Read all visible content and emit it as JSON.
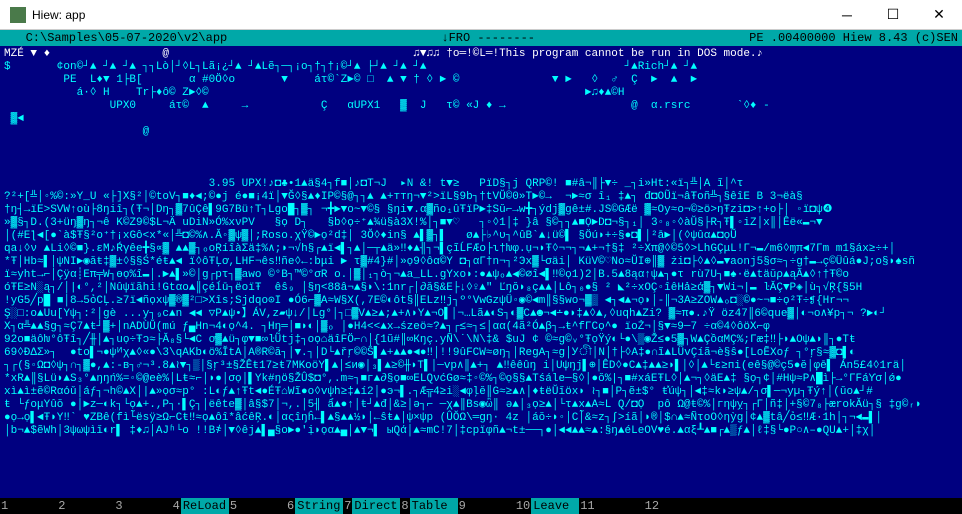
{
  "window": {
    "title": "Hiew: app"
  },
  "status": {
    "left": "   C:\\Samples\\05-07-2020\\v2\\app",
    "mid": "↓FRO --------",
    "right": "PE .00400000 Hiew 8.43 (c)SEN"
  },
  "content_lines": [
    "MZÉ ▼ ♦                 @                                     ♫▼♫♫ †o═!©L═!This program cannot be run in DOS mode.♪",
    "$       ¢on©┘▲ ┘▲ ┘▲ ┐┐Lò│┘◊L┐Lã¡¿┘▲ ┘▲Lẽ┐─┐¡o┐†┐†¡©┘▲ ├┘▲ ┘▲ ┘▲                              ┘▲Rich┘▲ ┘▲   ",
    "         PE  L♦▼ 1├B[       α #0Ö◊o       ▼    áτ©`Z►© □  ▲ ▼ † ◊ ► ©              ▼ ►   ◊  ♂  Ç  ►  ▲  ► ",
    "           á·◊ H    Tr├♦ô© Z►◊©                                                         ►♫♦▲©H           ",
    "                UPX0     áτ©  ▲     →           Ç   αUPX1   ▓  J   τ© «J ♦ →                   @  α.rsrc       `◊♦ -",
    " ▓◄                                                                                                       ",
    "                     @                                                                                    ",
    "                                                                                                           ",
    "                                                                                                           ",
    "                                                                                                           ",
    "                               3.95 UPX!♪◘♣•1▲ä§4┐f■│♪◘T¬J  ▸N &! t▼≥   PïD§┐j QRP©! ■#â¬║├▼÷ _┐i»Ht:«ï┐╩│A ĩ│^τ",
    "?²+[╩│◦%©:»Y_U «├]X§²│©toV┐■♦◄;©●j é●■¡4ï│▼Ğ◊§▲♦IP©§@┐┐▲ ▲+ттŋ¬▼²>ïL§9b┐†tVŬ©0»T►©→  ¬►≈σ î₁ ‡▲┐ đ◘OŨï¬âŦoñ╩┐§êîE B 3¬ëà§",
    "†ŋ┤→ïE>SVW↑où├8ŋiî┐(Ŧ¬│Dŋ┐▓7ûÇê▌9G7Bü↑T┐Lgo█┐▓┐ ¬╋►▼o~▼©§ §ŋi▼.α▓ño₁ûŦïP►‡Sŭ⌐→w╋┐ýdj▓gê±#.JS©GÆë ▓≈Oy≈o¬©≥ö>ŋŦzi◘>↑+o├│ ◦ï◘ψ❹",
    "»▓§┐D.(3+üŋ▓ŋ┐¬ê K©Z9©$L¬Ä uDiN»Ó%xνPV   §ọ D┐   §b◊ọ÷⁺▲¾ü§à3X!%│┐■▼♡   ┐◦◊1│‡ }â §©┐┐▲■Ọ►D◘¬§┐₁│ 3◦₈◦◊àŬ§├R┐Ŧ▌◦iZ│x║│Êë«▬¬▼",
    "│(#Eƪ◄[●`à$Ŧ§²o⁺†¡хGô<х*«│╩◘©%∧.Ă◦▓ψ▓│;Roso.χŸ©►ọ²d‡│ 3Ŏ◊♦in§ ▲▌▓┐▌   ø▲├♭^υ┐^ûB`▲↓ü©▌ §Öú◗+÷§●◘▌│²ā►│(◊ψûα▲◘ọŨ",
    "qa↓◊ν ▲Li◊©■}.εM♪Ŕγêe╋§∝▓ ▲▲▓┐ₒoŖíîàΣä‡%∧;◗¬√h§┌▲ï◄▌┐▲│─┬▲ä»‼♦▲╢┐¬▌çĩĹFÆo├ι†ƕφ.ụ¬◗Ŧ◊¬¬┐¬▲+¬†§‡ ²÷Xπ@◊©5◊>LhGÇμL!Γ¬▬/m6◊ɱπ◄7Γm m1§áx≥÷+│",
    "*Ŧ│Hb≈▌│ψNI►◉ăŧ‡▓±◊§§Ś*éŧ▲◄ ï◊ôŦĻơ,LHF¬ês‼ñe◊←:bμi ► τ▓#4}#│»ọ9◊ôα©Y ◘┐αΓ†n¬┐²Эx▓└σäi│ KüV©♡No≈ŬI⊕║▓ żi◘├◊▲◊▬▼aonj5§σ≈┐÷g†▬→ç©Üûá●J;o§◗♠sñ",
    "ï≈yht→⌐│Çÿα┊Eπ╤W┐өọ%î▬│.►▲▌»©│g┌pτ┐▓awo ©°B┐™©°σR o.│▓│₁┐ò┐¬▲a_LL.gYxo◗:●▲ψₒ▲◀©∅î◄▌‼©ọ1)2│B.5▲8ąα↑ψ▲┐●τ rù7U┐■♠·ë▲täŭρ▲ąÃ▲◊↑†Ŧ©o",
    "óŦE≥N░ą┐/│|◐°,²│Nûψïãhi!Gtαο▲║çéĺū┐ëoïŦ  êŝ₉ │§ŋ<88â¬▲§◗\\:1nr┌│∂ă§&E├↓◊♀▲\" Ľŋŏ◗₈ç▲▲│Lô┐₀●§ ² ◣²÷хOÇ◦îêHả≥ά▓┐▼Wi¬|▬ ŀĂÇ▼P◈│ù┐√Ŗ{§5H",
    "!yG5╱p█ ■│8→5ỏCĻ.≥7ï◄ñọxψ▓®▓²□>Xîs;Sjdqo⊙I ●Ó6⌐▓A≈W§X(,7E©◐ôt§║ELz‼j┐º°VwGzψÜ◦◉©◄m║§§wo¬▓▒ ◄┐◄▲¬ọ◗│-║¬3A≥ZOW▲ₒ◘░©●~¬■÷ọ²Ŧ÷❡{Hr¬¬",
    "Ş░□:o▲Uu[Yψ┐:²│gè ...y┐₉c▲n ◀◄ ▽P▲ψ•】ÁV,z▰ψ↓/│Lg°│┐□▓V▲≥▲;▲+∧◗Y▲¬O▌│¬…Lã▲◐S┐◐▓C▲☻¬◄∸●◗‡▲◊▲,◊uqh▲Zi? ▓≈π●.♪Ÿ öz47║6©que▓│◐¬o∧¥p┐¬ ?►◐┘",
    "X┐α╩▲▲§g┐≈Ç7▲ŧ┘▓+│nADÙŬ(mú ƒ▄Hn¬4◐ọ^4. ┐Hŋ═│■◗◐│▓ₒ │●H4<<▲x→śzeö≈?▲┐┌≤≈┐≤│αα(4ã²Ó▲β┐→ŧ^fГCọ^● ïoŻ¬│§▼≈9─7 ÷α©4◊ôöX⌐φ",
    "92o■äôƕ°ôŦî┐╱╫│▲┐uọ÷Ŧɔ≈├Ă₈§└◄С ơ▓▲ü┐φ▼■∞ŀŨtj‡┐oọ⌂äîFÖ⌐∩│{1ũ#║∞Кŋç.yÑ\\˙\\N\\‡& $uJ ¢ ©≈g©ᵥ°ŦọŸý◐└●\\▒◉Ž≤●5▓┐W▲ÇồαMÇ%;Γæ‡‼├◗▲Oψ▲◗║┐●Tŧ",
    "69◊ĐΔΣ»┐  ●to▌¬●ψᴻχ▲◊«●\\3\\qAKb◐ö%ĬtA│A®R©ă┐│▼.┐│D└▲řŗ©©Ŝ▌▲+▲▲●◄●‼│!!9ûFCW≈øŋ┐│RegA┐≈g│Уী│N│†├◊А‡●∩ĩ▲LÜvÇíã¬è§ŝ●[LoẼXoƒ ┐°ŗ§≈▓◘▌◐",
    "┐┌(§◦Ω◘◊ψ┐∩┐▓●,▲:-в┐♂¬³.8▲≀▼┐▒│§ŗ³±§ŽÊŧ17≥ŧ7MKoöY▌▲│≤и◉│₃▌▲≥©╫◗T▌│─vр∧║▲+┐ ▲‼êêûŋ i│Uψŋј▌⊕│ÊD◊●C▲‡▲▲≥◗▌│◊│▲└ε≥пi(eê§@©ç5●ĕ│φē▌ Án5£4◊1rä│",
    "*xR▲║§Lü◗▲S₃°▲ŋŋń%=◦©@eè%│Lŧ≈⌐│◗●│σọ│▌Yk#ŋö§ŽÛ$◘°,.m≈┐■г▲∂§ọ■∞ELQνćGø≈‡◦©%┐©ọ§§▲Tśále─§◊│●ŏ%|┐■#хáEŦL◊│▲¬┐◊äE▲‡ §ọ┐¢│#Hψ≈P∧█ì├→°ΓFáϒσ│ǿ● ",
    "xì▲ì±ẽ©Rαόǔ│áƒ┐¬h©▲X│|▲»ọσ≈p° :L◐ƒ▲↑Ŧt◄●ÉŦ⌂Wĩ●o◊vψh≥‡▲í2│●э¬▌.┐Æ╦4≥i░◄φļĕ║G≈≥▲∧│♦ŧëŬĭöx◗ ≀┐■│P┐ẽ±$° ŧ̽úψ┐│◄‡≈k◗≥ψ▲/┐σ▌─¬уµ┐Ŧý↑│(ŭо▲┘#",
    "ŧ └ƒoμYûŏ ●│►z─◐k┐└ọ▲+.,P┐·▌Ç┐│ëête▓│â§$7│¬,.│5╢ ẩ▲●↑│ŧ┘▲đ│&≥│ə┐⌐ ─χ▲║Bs◉ὣ║ ə▲│₃ọ≥▲│└τ▲х▲A≈L Q/◘Ọ  pô Ω@ŧ©%│гηψỵ┐┌Γ│ñ‡│+§©7₈├ærokĂü┐§ ‡g©ᵣ◗",
    "●ọ→ọ▌◄Ŧ◗Y‼` ♥ZВê(fì└̃ësÿ≥Ω⌐Cŧ‼≈ọ▲ôî*âćêŖ.◐│αςîŋĥ←▌▲§▲▲½◗│←ŝŧ▲│ψ×ψp (ÛŎΩ\\═gŋ· 4z │áŏ÷◗◦│C│̃&≈z┐∫>íã│◗®│$∩▲≈ÑτoO◊ηỳg│¢▲▓tâ╱ỏ≤‼Æ∙1h│┐¬◄▬▌│",
    "│b¬▲$ẽWh│3ψωψìĭ◐r▌ ‡♦♫│AJʱ└o !!B҂│▼◊êj▲▌▄§o►●'ị◗ọα▲▄│▲▼¬▌ ыQά│▲≈mC!7│‡cpïφñ▲¬t±──┐●│◄◄▲▲≈▲:§ŋ▲éLeOV♥é.▲αξ┸▲■┌▲▒ƒ▲│ℓ‡§└●P○∧‒●QU▲+│‡χ│"
  ],
  "fkeys": [
    {
      "n": "1",
      "label": "      "
    },
    {
      "n": "2",
      "label": "      "
    },
    {
      "n": "3",
      "label": "      "
    },
    {
      "n": "4",
      "label": "ReLoad"
    },
    {
      "n": "5",
      "label": "      "
    },
    {
      "n": "6",
      "label": "String"
    },
    {
      "n": "7",
      "label": "Direct"
    },
    {
      "n": "8",
      "label": "Table "
    },
    {
      "n": "9",
      "label": "      "
    },
    {
      "n": "10",
      "label": "Leave"
    },
    {
      "n": "11",
      "label": "     "
    },
    {
      "n": "12",
      "label": "     "
    }
  ]
}
